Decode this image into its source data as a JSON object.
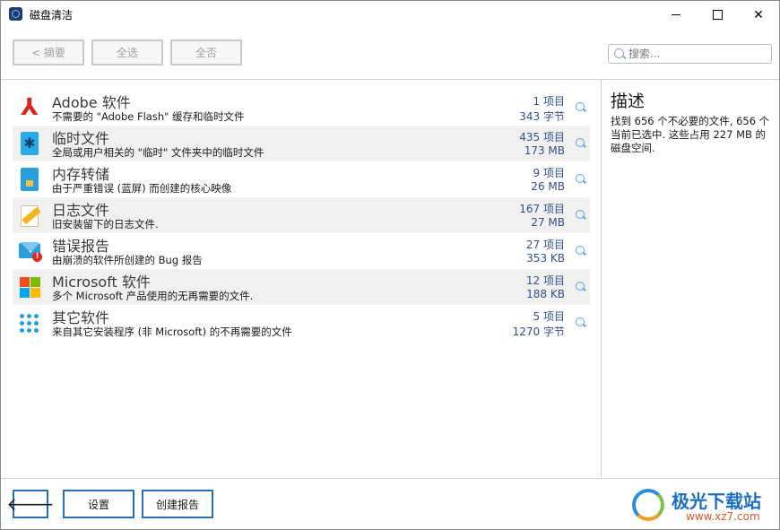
{
  "window": {
    "title": "磁盘清洁"
  },
  "toolbar": {
    "back_label": "< 摘要",
    "select_all_label": "全选",
    "select_none_label": "全否",
    "search_placeholder": "搜索..."
  },
  "items": [
    {
      "title": "Adobe 软件",
      "description": "不需要的 \"Adobe Flash\" 缓存和临时文件",
      "count": "1 项目",
      "size": "343 字节",
      "icon": "adobe-icon"
    },
    {
      "title": "临时文件",
      "description": "全局或用户相关的 \"临时\" 文件夹中的临时文件",
      "count": "435 项目",
      "size": "173 MB",
      "icon": "temp-file-icon"
    },
    {
      "title": "内存转储",
      "description": "由于严重错误 (蓝屏) 而创建的核心映像",
      "count": "9 项目",
      "size": "26 MB",
      "icon": "memory-card-icon"
    },
    {
      "title": "日志文件",
      "description": "旧安装留下的日志文件.",
      "count": "167 项目",
      "size": "27 MB",
      "icon": "log-pencil-icon"
    },
    {
      "title": "错误报告",
      "description": "由崩溃的软件所创建的 Bug 报告",
      "count": "27 项目",
      "size": "353 KB",
      "icon": "mail-error-icon"
    },
    {
      "title": "Microsoft 软件",
      "description": "多个 Microsoft 产品使用的无再需要的文件.",
      "count": "12 项目",
      "size": "188 KB",
      "icon": "microsoft-icon"
    },
    {
      "title": "其它软件",
      "description": "来自其它安装程序 (非 Microsoft) 的不再需要的文件",
      "count": "5 项目",
      "size": "1270 字节",
      "icon": "dots-grid-icon"
    }
  ],
  "description_panel": {
    "title": "描述",
    "text": "找到 656 个不必要的文件, 656 个当前已选中. 这些占用 227 MB 的磁盘空间."
  },
  "bottom": {
    "back_label": "🡐",
    "settings_label": "设置",
    "create_report_label": "创建报告"
  },
  "watermark": {
    "name": "极光下载站",
    "url": "www.xz7.com"
  },
  "colors": {
    "accent": "#2a6fb3",
    "count_text": "#2f4f8f",
    "row_alt": "#f0f0f0",
    "adobe_red": "#d7261f"
  }
}
